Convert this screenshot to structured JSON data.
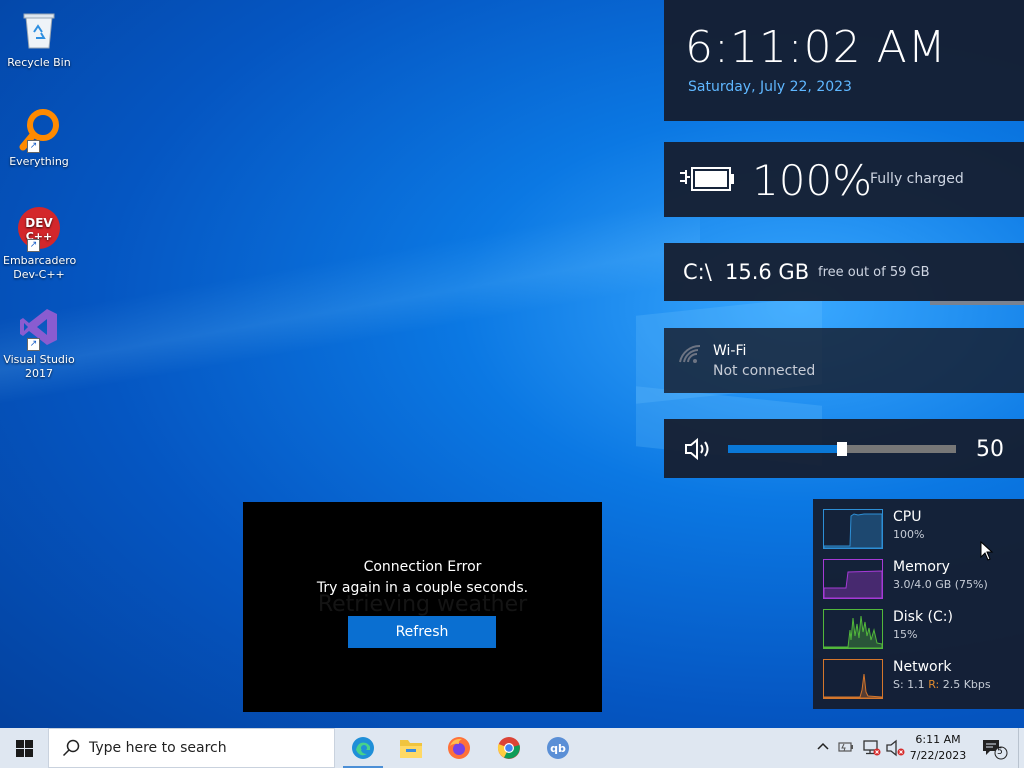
{
  "desktop": {
    "icons": [
      {
        "label": "Recycle Bin"
      },
      {
        "label": "Everything"
      },
      {
        "label": "Embarcadero Dev-C++",
        "logo_text": "DEV C++"
      },
      {
        "label": "Visual Studio 2017"
      }
    ]
  },
  "clock": {
    "time": "6:11:02 AM",
    "date": "Saturday, July 22, 2023"
  },
  "battery": {
    "percent": "100%",
    "status": "Fully charged"
  },
  "disk": {
    "drive": "C:\\",
    "free": "15.6 GB",
    "total": "free out of 59 GB"
  },
  "wifi": {
    "name": "Wi-Fi",
    "status": "Not connected"
  },
  "volume": {
    "value": "50",
    "level": 0.5
  },
  "performance": [
    {
      "name": "CPU",
      "value": "100%",
      "color": "#2d8fd6"
    },
    {
      "name": "Memory",
      "value": "3.0/4.0 GB (75%)",
      "color": "#a53ad6"
    },
    {
      "name": "Disk (C:)",
      "value": "15%",
      "color": "#52b83b"
    },
    {
      "name": "Network",
      "value_send": "S: 1.1 ",
      "value_recv_label": "R:",
      "value_recv": " 2.5 Kbps",
      "color": "#d4762c"
    }
  ],
  "dialog": {
    "title": "Connection Error",
    "message": "Try again in a couple seconds.",
    "background_text": "Retrieving weather",
    "button": "Refresh"
  },
  "taskbar": {
    "search_placeholder": "Type here to search",
    "apps": [
      "edge-icon",
      "file-explorer-icon",
      "firefox-icon",
      "chrome-icon",
      "qbittorrent-icon"
    ],
    "time": "6:11 AM",
    "date": "7/22/2023",
    "notification_count": "5"
  }
}
